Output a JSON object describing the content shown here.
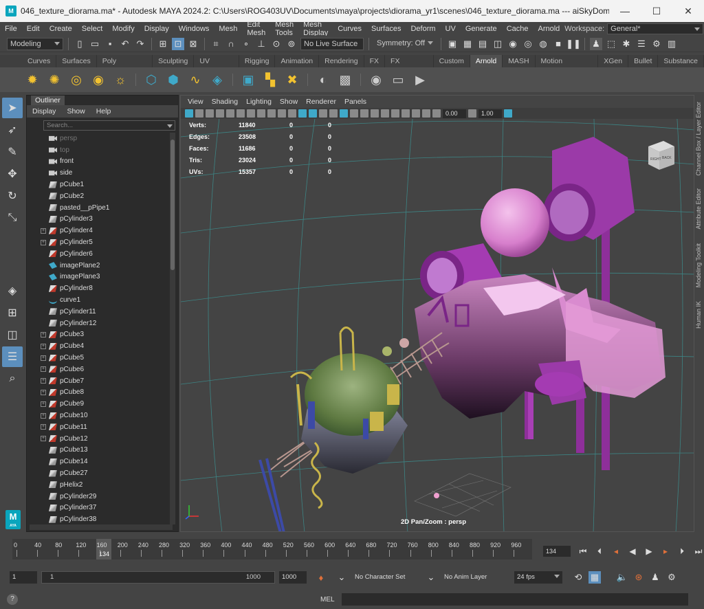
{
  "window": {
    "title": "046_texture_diorama.ma* - Autodesk MAYA 2024.2: C:\\Users\\ROG403UV\\Documents\\maya\\projects\\diorama_yr1\\scenes\\046_texture_diorama.ma   ---   aiSkyDomeLi...",
    "app_icon_label": "M"
  },
  "menubar": {
    "items": [
      "File",
      "Edit",
      "Create",
      "Select",
      "Modify",
      "Display",
      "Windows",
      "Mesh",
      "Edit Mesh",
      "Mesh Tools",
      "Mesh Display",
      "Curves",
      "Surfaces",
      "Deform",
      "UV",
      "Generate",
      "Cache",
      "Arnold"
    ],
    "workspace_label": "Workspace:",
    "workspace_value": "General*"
  },
  "statusline": {
    "mode": "Modeling",
    "live_surface": "No Live Surface",
    "symmetry": "Symmetry: Off"
  },
  "shelf": {
    "tabs": [
      "Curves",
      "Surfaces",
      "Poly Modeling",
      "Sculpting",
      "UV Editing",
      "Rigging",
      "Animation",
      "Rendering",
      "FX",
      "FX Caching",
      "Custom",
      "Arnold",
      "MASH",
      "Motion Graphics",
      "XGen",
      "Bullet",
      "Substance"
    ],
    "active_tab": "Arnold"
  },
  "outliner": {
    "tab": "Outliner",
    "menu": [
      "Display",
      "Show",
      "Help"
    ],
    "search_placeholder": "Search...",
    "items": [
      {
        "label": "persp",
        "icon": "camera-icon",
        "dim": true,
        "exp": false
      },
      {
        "label": "top",
        "icon": "camera-icon",
        "dim": true,
        "exp": false
      },
      {
        "label": "front",
        "icon": "camera-icon",
        "dim": false,
        "exp": false
      },
      {
        "label": "side",
        "icon": "camera-icon",
        "dim": false,
        "exp": false
      },
      {
        "label": "pCube1",
        "icon": "mesh-icon",
        "dim": false,
        "exp": false
      },
      {
        "label": "pCube2",
        "icon": "mesh-icon",
        "dim": false,
        "exp": false
      },
      {
        "label": "pasted__pPipe1",
        "icon": "mesh-icon",
        "dim": false,
        "exp": false
      },
      {
        "label": "pCylinder3",
        "icon": "mesh-icon",
        "dim": false,
        "exp": false
      },
      {
        "label": "pCylinder4",
        "icon": "mesh-red-icon",
        "dim": false,
        "exp": true
      },
      {
        "label": "pCylinder5",
        "icon": "mesh-red-icon",
        "dim": false,
        "exp": true
      },
      {
        "label": "pCylinder6",
        "icon": "mesh-red-icon",
        "dim": false,
        "exp": false
      },
      {
        "label": "imagePlane2",
        "icon": "image-plane-icon",
        "dim": false,
        "exp": false
      },
      {
        "label": "imagePlane3",
        "icon": "image-plane-icon",
        "dim": false,
        "exp": false
      },
      {
        "label": "pCylinder8",
        "icon": "mesh-red-icon",
        "dim": false,
        "exp": false
      },
      {
        "label": "curve1",
        "icon": "curve-icon",
        "dim": false,
        "exp": false
      },
      {
        "label": "pCylinder11",
        "icon": "mesh-icon",
        "dim": false,
        "exp": false
      },
      {
        "label": "pCylinder12",
        "icon": "mesh-icon",
        "dim": false,
        "exp": false
      },
      {
        "label": "pCube3",
        "icon": "mesh-red-icon",
        "dim": false,
        "exp": true
      },
      {
        "label": "pCube4",
        "icon": "mesh-red-icon",
        "dim": false,
        "exp": true
      },
      {
        "label": "pCube5",
        "icon": "mesh-red-icon",
        "dim": false,
        "exp": true
      },
      {
        "label": "pCube6",
        "icon": "mesh-red-icon",
        "dim": false,
        "exp": true
      },
      {
        "label": "pCube7",
        "icon": "mesh-red-icon",
        "dim": false,
        "exp": true
      },
      {
        "label": "pCube8",
        "icon": "mesh-red-icon",
        "dim": false,
        "exp": true
      },
      {
        "label": "pCube9",
        "icon": "mesh-red-icon",
        "dim": false,
        "exp": true
      },
      {
        "label": "pCube10",
        "icon": "mesh-red-icon",
        "dim": false,
        "exp": true
      },
      {
        "label": "pCube11",
        "icon": "mesh-red-icon",
        "dim": false,
        "exp": true
      },
      {
        "label": "pCube12",
        "icon": "mesh-red-icon",
        "dim": false,
        "exp": true
      },
      {
        "label": "pCube13",
        "icon": "mesh-icon",
        "dim": false,
        "exp": false
      },
      {
        "label": "pCube14",
        "icon": "mesh-icon",
        "dim": false,
        "exp": false
      },
      {
        "label": "pCube27",
        "icon": "mesh-icon",
        "dim": false,
        "exp": false
      },
      {
        "label": "pHelix2",
        "icon": "mesh-icon",
        "dim": false,
        "exp": false
      },
      {
        "label": "pCylinder29",
        "icon": "mesh-icon",
        "dim": false,
        "exp": false
      },
      {
        "label": "pCylinder37",
        "icon": "mesh-icon",
        "dim": false,
        "exp": false
      },
      {
        "label": "pCylinder38",
        "icon": "mesh-icon",
        "dim": false,
        "exp": false
      }
    ]
  },
  "viewport": {
    "menu": [
      "View",
      "Shading",
      "Lighting",
      "Show",
      "Renderer",
      "Panels"
    ],
    "exposure": "0.00",
    "gamma": "1.00",
    "hud": [
      {
        "label": "Verts:",
        "v": "11840",
        "a": "0",
        "b": "0"
      },
      {
        "label": "Edges:",
        "v": "23508",
        "a": "0",
        "b": "0"
      },
      {
        "label": "Faces:",
        "v": "11686",
        "a": "0",
        "b": "0"
      },
      {
        "label": "Tris:",
        "v": "23024",
        "a": "0",
        "b": "0"
      },
      {
        "label": "UVs:",
        "v": "15357",
        "a": "0",
        "b": "0"
      }
    ],
    "camera_label": "2D Pan/Zoom : persp",
    "viewcube_right": "RIGHT",
    "viewcube_back": "BACK"
  },
  "right_tabs": [
    "Channel Box / Layer Editor",
    "Attribute Editor",
    "Modeling Toolkit",
    "Human IK"
  ],
  "timeslider": {
    "ticks": [
      "0",
      "40",
      "80",
      "120",
      "160",
      "200",
      "240",
      "280",
      "320",
      "360",
      "400",
      "440",
      "480",
      "520",
      "560",
      "600",
      "640",
      "680",
      "720",
      "760",
      "800",
      "840",
      "880",
      "920",
      "960"
    ],
    "current_frame": "134",
    "current_frame_field": "134"
  },
  "range": {
    "start": "1",
    "inner_start": "1",
    "inner_end": "1000",
    "end": "1000",
    "character_set": "No Character Set",
    "anim_layer": "No Anim Layer",
    "fps": "24 fps"
  },
  "cmdline": {
    "help": "?",
    "mel_label": "MEL"
  },
  "colors": {
    "accent_blue": "#5c8fbd",
    "maya_teal": "#0aa5bd",
    "pink_model": "#d77fcc",
    "purple_model": "#8e2f9a",
    "green_island": "#6f8a4e"
  }
}
